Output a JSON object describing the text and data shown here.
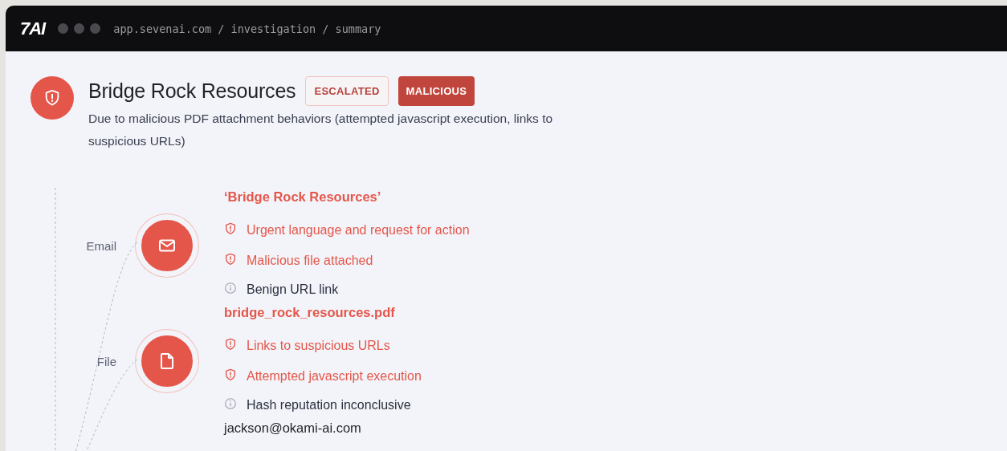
{
  "window": {
    "logo": "7AI",
    "url": "app.sevenai.com / investigation / summary"
  },
  "case": {
    "title": "Bridge Rock Resources",
    "badges": [
      {
        "label": "ESCALATED",
        "kind": "outline"
      },
      {
        "label": "MALICIOUS",
        "kind": "solid"
      }
    ],
    "description": "Due to malicious PDF attachment behaviors (attempted javascript execution, links to suspicious URLs)"
  },
  "groups": [
    {
      "label": "Email",
      "kind": "email",
      "title": "‘Bridge Rock Resources’",
      "flagged": true,
      "findings": [
        {
          "text": "Urgent language and request for action",
          "kind": "malicious"
        },
        {
          "text": "Malicious file attached",
          "kind": "malicious"
        },
        {
          "text": "Benign URL link",
          "kind": "info"
        }
      ]
    },
    {
      "label": "File",
      "kind": "file",
      "title": "bridge_rock_resources.pdf",
      "flagged": true,
      "findings": [
        {
          "text": "Links to suspicious URLs",
          "kind": "malicious"
        },
        {
          "text": "Attempted javascript execution",
          "kind": "malicious"
        },
        {
          "text": "Hash reputation inconclusive",
          "kind": "info"
        }
      ]
    },
    {
      "kind": "sender",
      "title": "jackson@okami-ai.com",
      "flagged": false
    }
  ]
}
